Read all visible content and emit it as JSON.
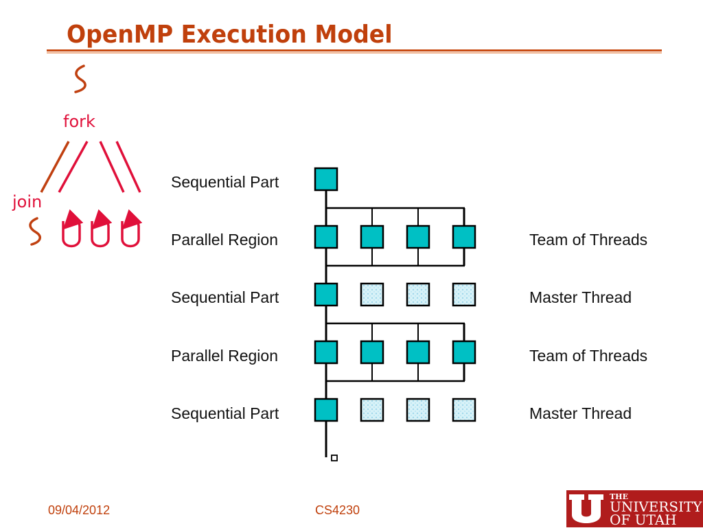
{
  "slide": {
    "title": "OpenMP Execution Model"
  },
  "sketch": {
    "fork_label": "fork",
    "join_label": "join"
  },
  "diagram": {
    "left_labels": [
      "Sequential Part",
      "Parallel Region",
      "Sequential Part",
      "Parallel Region",
      "Sequential Part"
    ],
    "right_labels": [
      "",
      "Team of Threads",
      "Master Thread",
      "Team of Threads",
      "Master Thread"
    ],
    "rows": [
      {
        "type": "sequential",
        "threads_active": 1,
        "threads_total": 1
      },
      {
        "type": "parallel",
        "threads_active": 4,
        "threads_total": 4
      },
      {
        "type": "sequential",
        "threads_active": 1,
        "threads_total": 4
      },
      {
        "type": "parallel",
        "threads_active": 4,
        "threads_total": 4
      },
      {
        "type": "sequential",
        "threads_active": 1,
        "threads_total": 4
      }
    ],
    "colors": {
      "active_thread": "#00c0c4",
      "idle_thread": "#c8eef6",
      "line": "#000000"
    }
  },
  "footer": {
    "date": "09/04/2012",
    "course": "CS4230",
    "logo": {
      "the": "THE",
      "line1": "UNIVERSITY",
      "line2": "OF UTAH"
    }
  }
}
